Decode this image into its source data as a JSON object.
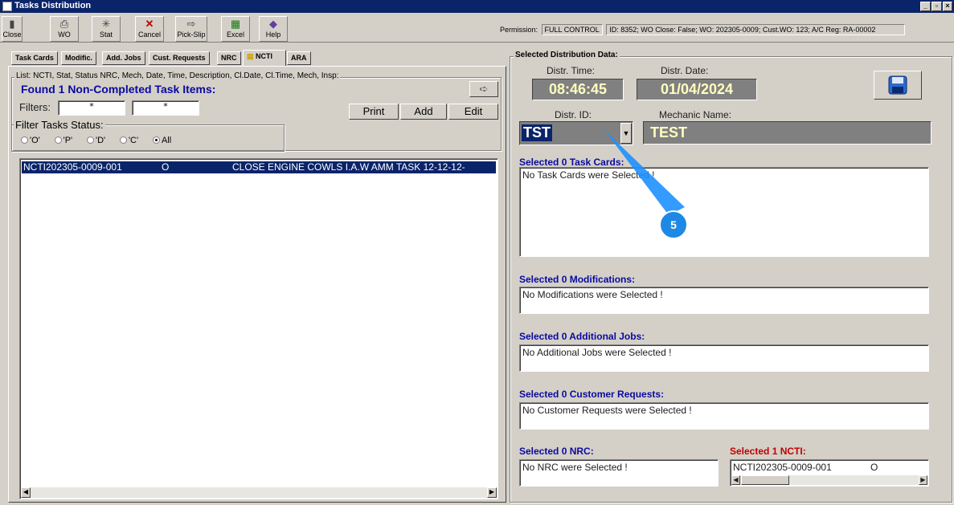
{
  "window": {
    "title": "Tasks Distribution",
    "controls": [
      "_",
      "▫",
      "×"
    ]
  },
  "toolbar": [
    {
      "label": "Close",
      "icon": "close-door-icon"
    },
    {
      "label": "WO",
      "icon": "printer-icon"
    },
    {
      "label": "Stat",
      "icon": "stat-icon"
    },
    {
      "label": "Cancel",
      "icon": "cancel-x-icon"
    },
    {
      "label": "Pick-Slip",
      "icon": "pick-slip-icon"
    },
    {
      "label": "Excel",
      "icon": "excel-icon"
    },
    {
      "label": "Help",
      "icon": "help-icon"
    }
  ],
  "permission": {
    "label": "Permission:",
    "value": "FULL CONTROL",
    "info": "ID: 8352; WO Close: False; WO: 202305-0009; Cust.WO: 123; A/C Reg: RA-00002"
  },
  "tabs": [
    "Task Cards",
    "Modific.",
    "Add. Jobs",
    "Cust. Requests",
    "NRC",
    "NCTI",
    "ARA"
  ],
  "left": {
    "group_label": "List: NCTI, Stat, Status NRC, Mech, Date, Time, Description, Cl.Date, Cl.Time, Mech, Insp:",
    "found": "Found 1 Non-Completed Task Items:",
    "filters_label": "Filters:",
    "filter1": "*",
    "filter2": "*",
    "print": "Print",
    "add": "Add",
    "edit": "Edit",
    "status_label": "Filter Tasks Status:",
    "radios": [
      "'O'",
      "'P'",
      "'D'",
      "'C'",
      "All"
    ],
    "selected_radio": "All",
    "rows": [
      {
        "id": "NCTI202305-0009-001",
        "stat": "O",
        "desc": "CLOSE ENGINE COWLS I.A.W AMM TASK 12-12-12-"
      }
    ]
  },
  "right": {
    "group_label": "Selected Distribution Data:",
    "time_label": "Distr. Time:",
    "time": "08:46:45",
    "date_label": "Distr. Date:",
    "date": "01/04/2024",
    "id_label": "Distr. ID:",
    "id": "TST",
    "mech_label": "Mechanic Name:",
    "mech": "TEST",
    "task_head": "Selected 0 Task Cards:",
    "task_text": "No Task Cards were Selected !",
    "mod_head": "Selected 0 Modifications:",
    "mod_text": "No Modifications were Selected !",
    "jobs_head": "Selected 0 Additional Jobs:",
    "jobs_text": "No Additional Jobs were Selected !",
    "cust_head": "Selected 0 Customer Requests:",
    "cust_text": "No Customer Requests were Selected !",
    "nrc_head": "Selected 0 NRC:",
    "nrc_text": "No NRC were Selected !",
    "ncti_head": "Selected 1 NCTI:",
    "ncti_row": "NCTI202305-0009-001",
    "ncti_stat": "O"
  },
  "callout": {
    "number": "5",
    "color": "#1e90ff"
  }
}
